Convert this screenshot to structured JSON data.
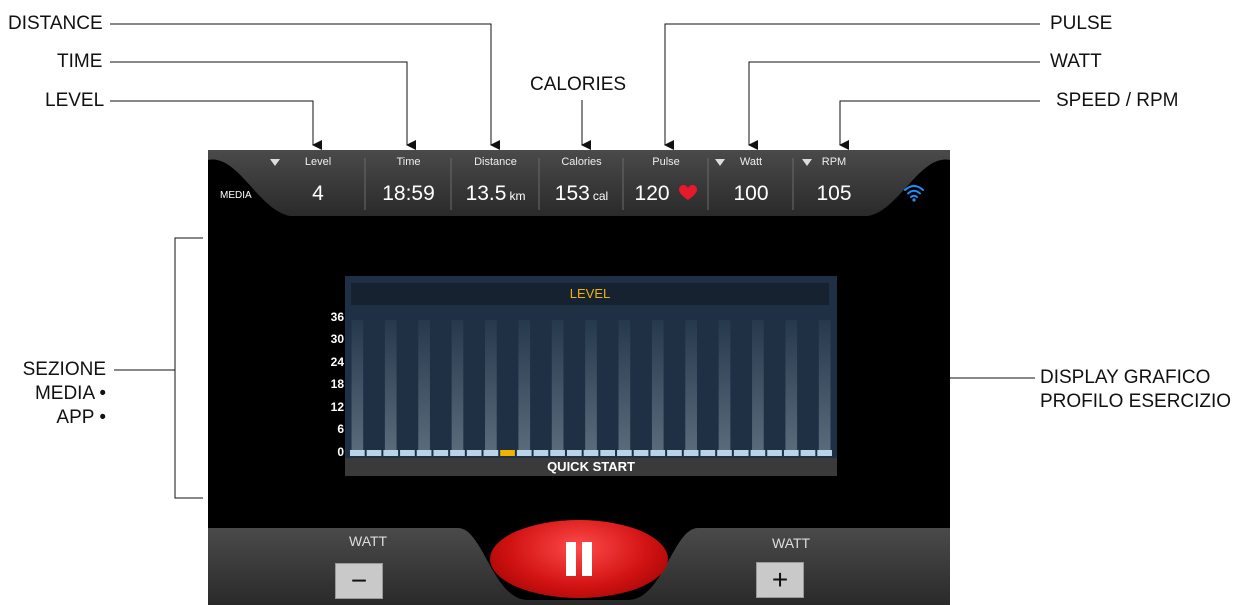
{
  "callouts": {
    "distance": "DISTANCE",
    "time": "TIME",
    "level": "LEVEL",
    "calories": "CALORIES",
    "pulse": "PULSE",
    "watt": "WATT",
    "speed_rpm": "SPEED / RPM",
    "media_section": [
      "SEZIONE",
      "MEDIA •",
      "APP •"
    ],
    "graph_display": [
      "DISPLAY GRAFICO",
      "PROFILO ESERCIZIO"
    ]
  },
  "console": {
    "media_label": "MEDIA",
    "metrics": {
      "level": {
        "label": "Level",
        "value": "4"
      },
      "time": {
        "label": "Time",
        "value": "18:59"
      },
      "distance": {
        "label": "Distance",
        "value": "13.5",
        "unit": "km"
      },
      "calories": {
        "label": "Calories",
        "value": "153",
        "unit": "cal"
      },
      "pulse": {
        "label": "Pulse",
        "value": "120"
      },
      "watt": {
        "label": "Watt",
        "value": "100"
      },
      "rpm": {
        "label": "RPM",
        "value": "105"
      }
    },
    "icons": [
      "heart-icon",
      "wifi-icon",
      "dropdown-triangle-icon"
    ],
    "colors": {
      "heart": "#e8192c",
      "wifi": "#1e90ff",
      "pause_button": "#d11212",
      "graph_title": "#f0b400",
      "current_segment": "#f0b400"
    }
  },
  "graph": {
    "title": "LEVEL",
    "footer": "QUICK START",
    "y_ticks": [
      "36",
      "30",
      "24",
      "18",
      "12",
      "6",
      "0"
    ],
    "segment_count": 29,
    "current_segment_index": 9
  },
  "controls": {
    "left": {
      "label": "WATT",
      "symbol": "−"
    },
    "right": {
      "label": "WATT",
      "symbol": "+"
    },
    "pause_icon": "pause-icon"
  }
}
